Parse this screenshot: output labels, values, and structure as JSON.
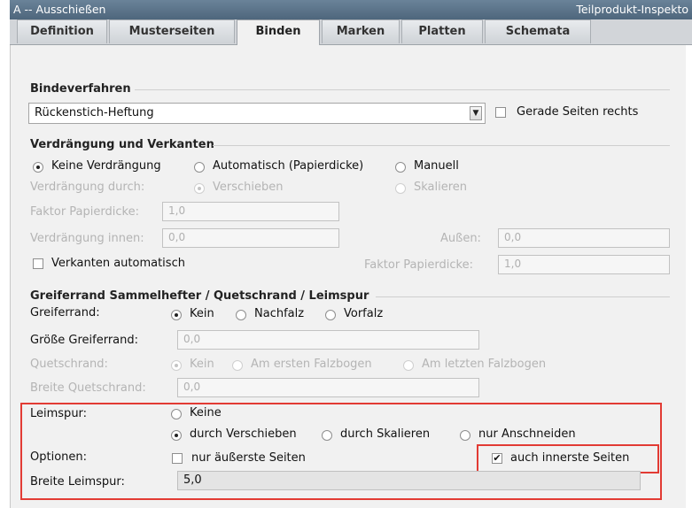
{
  "window": {
    "title": "A -- Ausschießen",
    "right_title": "Teilprodukt-Inspekto"
  },
  "tabs": [
    "Definition",
    "Musterseiten",
    "Binden",
    "Marken",
    "Platten",
    "Schemata"
  ],
  "active_tab": "Binden",
  "bindeverfahren": {
    "title": "Bindeverfahren",
    "selected": "Rückenstich-Heftung",
    "checkbox_label": "Gerade Seiten rechts",
    "checkbox_checked": false
  },
  "verdraengung": {
    "title": "Verdrängung und Verkanten",
    "options": [
      "Keine Verdrängung",
      "Automatisch (Papierdicke)",
      "Manuell"
    ],
    "by_label": "Verdrängung durch:",
    "by_options": [
      "Verschieben",
      "Skalieren"
    ],
    "factor_label": "Faktor Papierdicke:",
    "factor_value": "1,0",
    "inner_label": "Verdrängung innen:",
    "inner_value": "0,0",
    "outer_label": "Außen:",
    "outer_value": "0,0",
    "verkanten_label": "Verkanten automatisch",
    "factor2_label": "Faktor Papierdicke:",
    "factor2_value": "1,0"
  },
  "greifer": {
    "title": "Greiferrand Sammelhefter / Quetschrand / Leimspur",
    "greiferrand_label": "Greiferrand:",
    "greiferrand_options": [
      "Kein",
      "Nachfalz",
      "Vorfalz"
    ],
    "size_label": "Größe Greiferrand:",
    "size_value": "0,0",
    "quetsch_label": "Quetschrand:",
    "quetsch_options": [
      "Kein",
      "Am ersten Falzbogen",
      "Am letzten Falzbogen"
    ],
    "quetsch_width_label": "Breite Quetschrand:",
    "quetsch_width_value": "0,0"
  },
  "leimspur": {
    "label": "Leimspur:",
    "options": [
      "Keine",
      "durch Verschieben",
      "durch Skalieren",
      "nur Anschneiden"
    ],
    "options_label": "Optionen:",
    "outer_pages_label": "nur äußerste Seiten",
    "outer_pages_checked": false,
    "inner_pages_label": "auch innerste Seiten",
    "inner_pages_checked": true,
    "width_label": "Breite Leimspur:",
    "width_value": "5,0"
  },
  "highlight_color": "#e23b34"
}
